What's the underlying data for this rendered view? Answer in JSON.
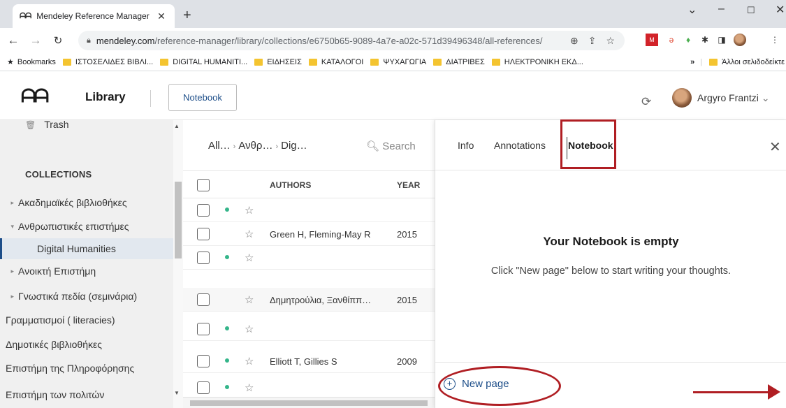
{
  "browser": {
    "tab_title": "Mendeley Reference Manager",
    "url_host": "mendeley.com",
    "url_path": "/reference-manager/library/collections/e6750b65-9089-4a7e-a02c-571d39496348/all-references/",
    "bookmarks_label": "Bookmarks",
    "bookmark_folders": [
      "ΙΣΤΟΣΕΛΙΔΕΣ ΒΙΒΛΙ...",
      "DIGITAL HUMANITI...",
      "ΕΙΔΗΣΕΙΣ",
      "ΚΑΤΑΛΟΓΟΙ",
      "ΨΥΧΑΓΩΓΙΑ",
      "ΔΙΑΤΡΙΒΕΣ",
      "ΗΛΕΚΤΡΟΝΙΚΗ ΕΚΔ..."
    ],
    "other_bookmarks": "Άλλοι σελιδοδείκτε"
  },
  "header": {
    "library_label": "Library",
    "notebook_button": "Notebook",
    "user_name": "Argyro Frantzi"
  },
  "sidebar": {
    "trash_label": "Trash",
    "collections_header": "COLLECTIONS",
    "items": [
      {
        "label": "Ακαδημαϊκές βιβλιοθήκες",
        "caret": "▸"
      },
      {
        "label": "Ανθρωπιστικές επιστήμες",
        "caret": "▾"
      },
      {
        "label": "Digital Humanities",
        "caret": ""
      },
      {
        "label": "Ανοικτή Επιστήμη",
        "caret": "▸"
      },
      {
        "label": "Γνωστικά πεδία (σεμινάρια)",
        "caret": "▸"
      },
      {
        "label": "Γραμματισμοί ( literacies)",
        "caret": ""
      },
      {
        "label": "Δημοτικές βιβλιοθήκες",
        "caret": ""
      },
      {
        "label": "Επιστήμη της Πληροφόρησης",
        "caret": ""
      },
      {
        "label": "Επιστήμη των πολιτών",
        "caret": ""
      }
    ]
  },
  "reflist": {
    "crumb_1": "All…",
    "crumb_2": "Ανθρ…",
    "crumb_3": "Dig…",
    "search_label": "Search",
    "col_authors": "AUTHORS",
    "col_year": "YEAR",
    "rows": [
      {
        "authors": "",
        "year": "",
        "unread": true
      },
      {
        "authors": "Green H, Fleming-May R",
        "year": "2015",
        "unread": false
      },
      {
        "authors": "",
        "year": "",
        "unread": true
      },
      {
        "authors": "Δημητρούλια, Ξανθίππ…",
        "year": "2015",
        "unread": false
      },
      {
        "authors": "",
        "year": "",
        "unread": true
      },
      {
        "authors": "Elliott T, Gillies S",
        "year": "2009",
        "unread": true
      },
      {
        "authors": "",
        "year": "",
        "unread": true
      }
    ]
  },
  "panel": {
    "tab_info": "Info",
    "tab_annotations": "Annotations",
    "tab_notebook": "Notebook",
    "empty_title": "Your Notebook is empty",
    "empty_message": "Click \"New page\" below to start writing your thoughts.",
    "new_page_label": "New page"
  },
  "colors": {
    "accent": "#1d4e89",
    "annotation_red": "#b01e23",
    "unread_dot": "#34b58a"
  }
}
